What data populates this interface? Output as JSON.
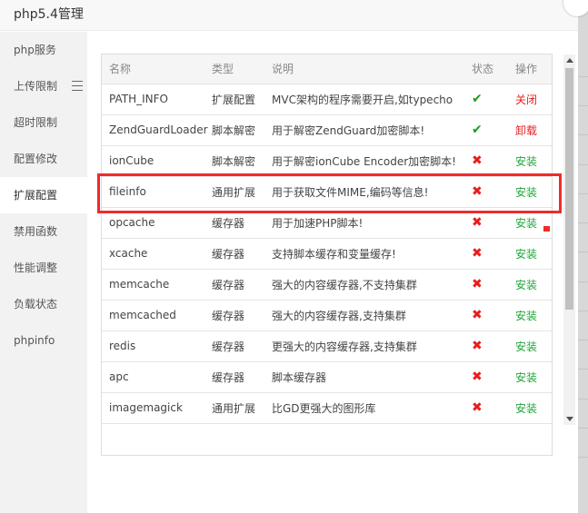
{
  "dialog": {
    "title": "php5.4管理"
  },
  "sidebar": {
    "items": [
      {
        "label": "php服务"
      },
      {
        "label": "上传限制"
      },
      {
        "label": "超时限制"
      },
      {
        "label": "配置修改"
      },
      {
        "label": "扩展配置"
      },
      {
        "label": "禁用函数"
      },
      {
        "label": "性能调整"
      },
      {
        "label": "负载状态"
      },
      {
        "label": "phpinfo"
      }
    ],
    "active_index": 4
  },
  "table": {
    "columns": [
      "名称",
      "类型",
      "说明",
      "状态",
      "操作"
    ],
    "rows": [
      {
        "name": "PATH_INFO",
        "type": "扩展配置",
        "desc": "MVC架构的程序需要开启,如typecho",
        "status": "✔",
        "status_ok": true,
        "action": "关闭",
        "action_kind": "red"
      },
      {
        "name": "ZendGuardLoader",
        "type": "脚本解密",
        "desc": "用于解密ZendGuard加密脚本!",
        "status": "✔",
        "status_ok": true,
        "action": "卸载",
        "action_kind": "red"
      },
      {
        "name": "ionCube",
        "type": "脚本解密",
        "desc": "用于解密ionCube Encoder加密脚本!",
        "status": "✖",
        "status_ok": false,
        "action": "安装",
        "action_kind": "install"
      },
      {
        "name": "fileinfo",
        "type": "通用扩展",
        "desc": "用于获取文件MIME,编码等信息!",
        "status": "✖",
        "status_ok": false,
        "action": "安装",
        "action_kind": "install"
      },
      {
        "name": "opcache",
        "type": "缓存器",
        "desc": "用于加速PHP脚本!",
        "status": "✖",
        "status_ok": false,
        "action": "安装",
        "action_kind": "install"
      },
      {
        "name": "xcache",
        "type": "缓存器",
        "desc": "支持脚本缓存和变量缓存!",
        "status": "✖",
        "status_ok": false,
        "action": "安装",
        "action_kind": "install"
      },
      {
        "name": "memcache",
        "type": "缓存器",
        "desc": "强大的内容缓存器,不支持集群",
        "status": "✖",
        "status_ok": false,
        "action": "安装",
        "action_kind": "install"
      },
      {
        "name": "memcached",
        "type": "缓存器",
        "desc": "强大的内容缓存器,支持集群",
        "status": "✖",
        "status_ok": false,
        "action": "安装",
        "action_kind": "install"
      },
      {
        "name": "redis",
        "type": "缓存器",
        "desc": "更强大的内容缓存器,支持集群",
        "status": "✖",
        "status_ok": false,
        "action": "安装",
        "action_kind": "install"
      },
      {
        "name": "apc",
        "type": "缓存器",
        "desc": "脚本缓存器",
        "status": "✖",
        "status_ok": false,
        "action": "安装",
        "action_kind": "install"
      },
      {
        "name": "imagemagick",
        "type": "通用扩展",
        "desc": "比GD更强大的图形库",
        "status": "✖",
        "status_ok": false,
        "action": "安装",
        "action_kind": "install"
      }
    ]
  },
  "icons": {
    "menu": "menu-icon",
    "check": "check-icon",
    "cross": "cross-icon",
    "close": "close-icon"
  },
  "colors": {
    "ok": "#1a9c1a",
    "no": "#e81e1e",
    "install": "#20a53a",
    "highlight": "#ee2b2b"
  }
}
